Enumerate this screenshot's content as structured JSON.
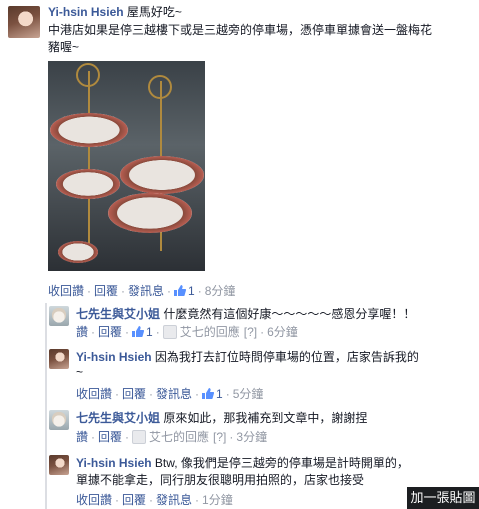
{
  "comments": [
    {
      "author": "Yi-hsin Hsieh",
      "text_line1": "屋馬好吃~",
      "text_line2": "中港店如果是停三越樓下或是三越旁的停車場，憑停車單據會送一盤梅花",
      "text_line3": "豬喔~",
      "actions": {
        "like": "收回讚",
        "reply": "回覆",
        "message": "發訊息",
        "likes": "1",
        "time": "8分鐘"
      }
    },
    {
      "author": "七先生與艾小姐",
      "text": "什麼竟然有這個好康～～～～～感恩分享喔！！",
      "actions": {
        "like": "讚",
        "reply": "回覆",
        "likes": "1",
        "page": "艾七的回應",
        "flag": "[?]",
        "time": "6分鐘"
      }
    },
    {
      "author": "Yi-hsin Hsieh",
      "text_line1": "因為我打去訂位時問停車場的位置，店家告訴我的",
      "text_line2": "~",
      "actions": {
        "like": "收回讚",
        "reply": "回覆",
        "message": "發訊息",
        "likes": "1",
        "time": "5分鐘"
      }
    },
    {
      "author": "七先生與艾小姐",
      "text": "原來如此，那我補充到文章中，謝謝捏",
      "actions": {
        "like": "讚",
        "reply": "回覆",
        "page": "艾七的回應",
        "flag": "[?]",
        "time": "3分鐘"
      }
    },
    {
      "author": "Yi-hsin Hsieh",
      "text_line1": "Btw, 像我們是停三越旁的停車場是計時開單的，",
      "text_line2": "單據不能拿走，同行朋友很聰明用拍照的，店家也接受",
      "actions": {
        "like": "收回讚",
        "reply": "回覆",
        "message": "發訊息",
        "time": "1分鐘"
      }
    }
  ],
  "overlay_button": "加一張貼圖",
  "icons": {
    "thumb": "thumbs-up-icon",
    "page": "page-avatar-icon"
  },
  "colors": {
    "link": "#3b5998",
    "meta": "#9197a3",
    "text": "#141823"
  }
}
